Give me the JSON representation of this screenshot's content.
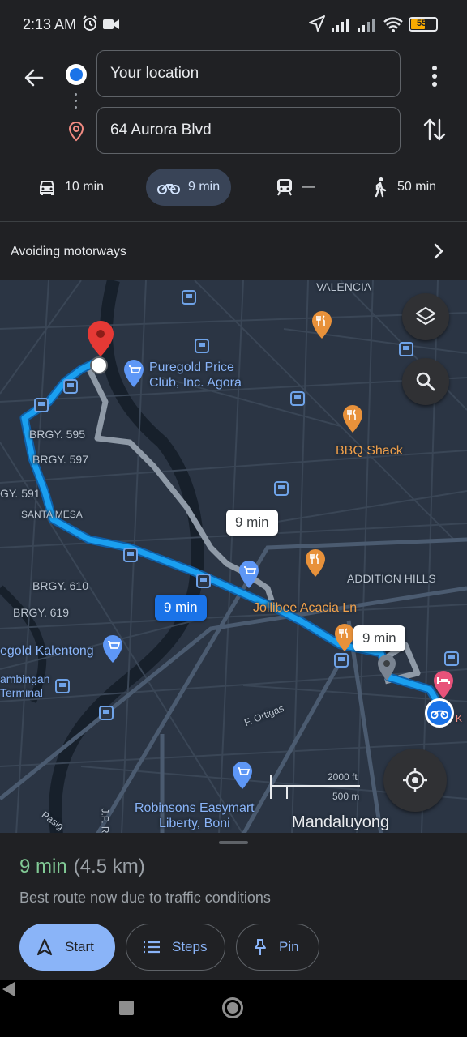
{
  "status_bar": {
    "time": "2:13 AM",
    "battery": "55"
  },
  "header": {
    "origin_value": "Your location",
    "destination_value": "64 Aurora Blvd"
  },
  "modes": [
    {
      "icon": "car-icon",
      "label": "10 min"
    },
    {
      "icon": "motorcycle-icon",
      "label": "9 min",
      "selected": true
    },
    {
      "icon": "transit-icon",
      "label": "—"
    },
    {
      "icon": "walk-icon",
      "label": "50 min"
    }
  ],
  "options_row": {
    "label": "Avoiding motorways"
  },
  "map": {
    "place_labels": {
      "valencia": "VALENCIA",
      "puregold_price_club": "Puregold Price Club, Inc. Agora",
      "brgy_595": "BRGY. 595",
      "brgy_597": "BRGY. 597",
      "brgy_591": "GY. 591",
      "santa_mesa": "SANTA MESA",
      "bbq_shack": "BBQ Shack",
      "addition_hills": "ADDITION HILLS",
      "brgy_610": "BRGY. 610",
      "brgy_619": "BRGY. 619",
      "jollibee": "Jollibee Acacia Ln",
      "puregold_kalentong": "egold Kalentong",
      "terminal": "ambingan\nTerminal",
      "f_ortigas": "F. Ortigas",
      "robinsons": "Robinsons Easymart\nLiberty, Boni",
      "mandaluyong": "Mandaluyong",
      "pasig": "Pasig",
      "jp_rizal": "J.P. R",
      "k_partial": "K"
    },
    "route_bubbles": {
      "main": "9 min",
      "alt1": "9 min",
      "alt2": "9 min"
    },
    "scale": {
      "imperial": "2000 ft",
      "metric": "500 m"
    }
  },
  "bottom_sheet": {
    "eta_time": "9 min",
    "eta_distance": "(4.5 km)",
    "note": "Best route now due to traffic conditions",
    "start_label": "Start",
    "steps_label": "Steps",
    "pin_label": "Pin"
  },
  "colors": {
    "route_primary": "#1a9ff0",
    "route_alt": "#9aa7b5",
    "destination_pin": "#e53935",
    "accent_blue": "#8ab4f8",
    "eta_green": "#81c995"
  }
}
